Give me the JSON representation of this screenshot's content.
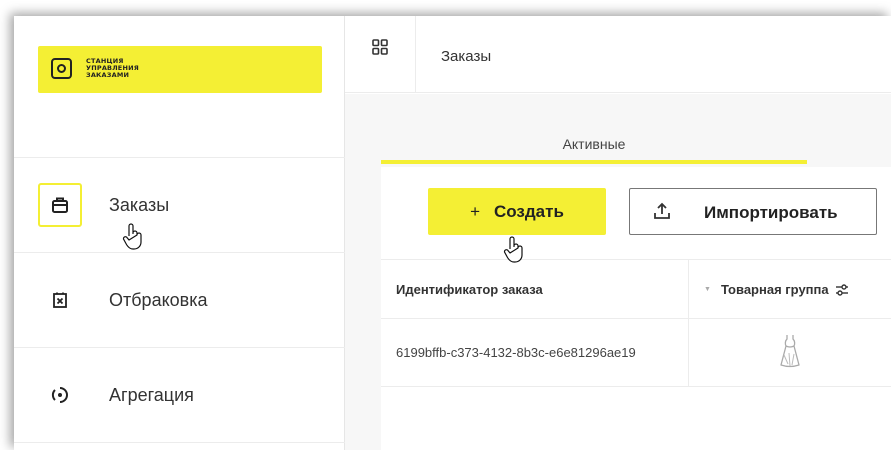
{
  "sidebar": {
    "logo": {
      "lines": [
        "СТАНЦИЯ",
        "УПРАВЛЕНИЯ",
        "ЗАКАЗАМИ"
      ],
      "icon": "gear-box-icon"
    },
    "items": [
      {
        "label": "Заказы",
        "icon": "briefcase-icon",
        "active": true
      },
      {
        "label": "Отбраковка",
        "icon": "reject-box-icon",
        "active": false
      },
      {
        "label": "Агрегация",
        "icon": "aggregation-icon",
        "active": false
      }
    ]
  },
  "header": {
    "title": "Заказы",
    "menu_icon": "grid-icon"
  },
  "tabs": [
    {
      "label": "Активные",
      "active": true
    }
  ],
  "toolbar": {
    "create_plus": "+",
    "create_label": "Создать",
    "import_label": "Импортировать",
    "import_icon": "upload-icon"
  },
  "table": {
    "columns": {
      "id": "Идентификатор заказа",
      "group": "Товарная группа"
    },
    "rows": [
      {
        "id": "6199bffb-c373-4132-8b3c-e6e81296ae19",
        "group_icon": "dress-icon"
      }
    ]
  },
  "colors": {
    "accent": "#f4ef34",
    "text": "#222222",
    "border": "#ececec"
  }
}
